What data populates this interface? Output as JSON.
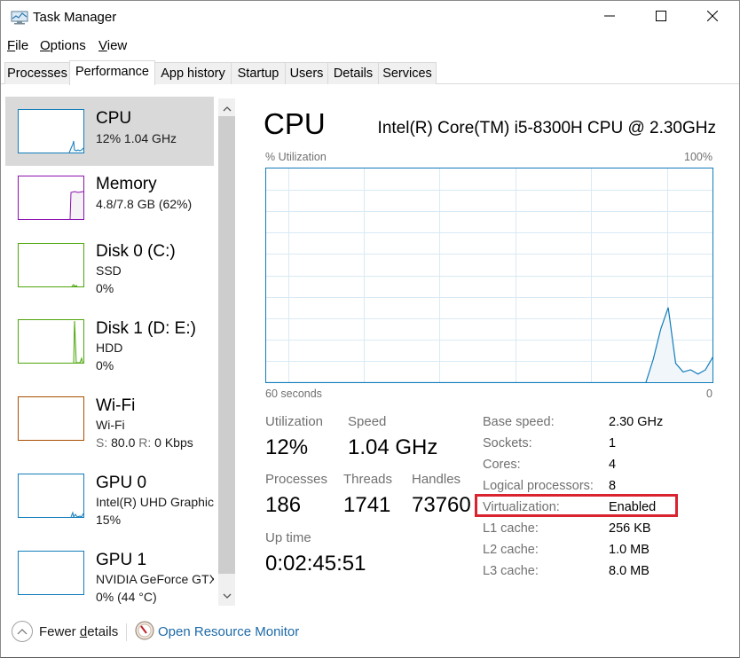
{
  "window": {
    "title": "Task Manager",
    "icon": "task-manager-icon",
    "controls": [
      "minimize-icon",
      "maximize-icon",
      "close-icon"
    ]
  },
  "menu": {
    "items": [
      {
        "label": "File",
        "accel": "F",
        "rest": "ile"
      },
      {
        "label": "Options",
        "accel": "O",
        "rest": "ptions"
      },
      {
        "label": "View",
        "accel": "V",
        "rest": "iew"
      }
    ]
  },
  "tabs": [
    {
      "label": "Processes",
      "active": false
    },
    {
      "label": "Performance",
      "active": true
    },
    {
      "label": "App history",
      "active": false
    },
    {
      "label": "Startup",
      "active": false
    },
    {
      "label": "Users",
      "active": false
    },
    {
      "label": "Details",
      "active": false
    },
    {
      "label": "Services",
      "active": false
    }
  ],
  "sidebar": {
    "items": [
      {
        "title": "CPU",
        "line1": "12%  1.04 GHz",
        "line2": "",
        "color": "#117dbb",
        "fill": "#f1f6fa",
        "selected": true
      },
      {
        "title": "Memory",
        "line1": "4.8/7.8 GB (62%)",
        "line2": "",
        "color": "#8b12ae",
        "fill": "#f4f2f4",
        "selected": false,
        "usage": 0.62
      },
      {
        "title": "Disk 0 (C:)",
        "line1": "SSD",
        "line2": "0%",
        "color": "#4da60c",
        "fill": "#eff7e9",
        "selected": false
      },
      {
        "title": "Disk 1 (D: E:)",
        "line1": "HDD",
        "line2": "0%",
        "color": "#4da60c",
        "fill": "#eff7e9",
        "selected": false
      },
      {
        "title": "Wi-Fi",
        "line1": "Wi-Fi",
        "line2_s_label": "S:",
        "line2_s_value": "80.0",
        "line2_r_label": "R:",
        "line2_r_value": "0 Kbps",
        "color": "#a74f01",
        "fill": "#fcf3eb",
        "selected": false
      },
      {
        "title": "GPU 0",
        "line1": "Intel(R) UHD Graphics",
        "line2": "15%",
        "color": "#117dbb",
        "fill": "#f1f6fa",
        "selected": false
      },
      {
        "title": "GPU 1",
        "line1": "NVIDIA GeForce GTX",
        "line2": "0%  (44 °C)",
        "color": "#117dbb",
        "fill": "#f1f6fa",
        "selected": false
      }
    ]
  },
  "main": {
    "title": "CPU",
    "cpu_name": "Intel(R) Core(TM) i5-8300H CPU @ 2.30GHz",
    "graph": {
      "y_label": "% Utilization",
      "y_max_label": "100%",
      "x_left_label": "60 seconds",
      "x_right_label": "0"
    },
    "stats": {
      "utilization_label": "Utilization",
      "utilization_value": "12%",
      "speed_label": "Speed",
      "speed_value": "1.04 GHz",
      "processes_label": "Processes",
      "processes_value": "186",
      "threads_label": "Threads",
      "threads_value": "1741",
      "handles_label": "Handles",
      "handles_value": "73760",
      "uptime_label": "Up time",
      "uptime_value": "0:02:45:51"
    },
    "specs": [
      {
        "label": "Base speed:",
        "value": "2.30 GHz"
      },
      {
        "label": "Sockets:",
        "value": "1"
      },
      {
        "label": "Cores:",
        "value": "4"
      },
      {
        "label": "Logical processors:",
        "value": "8"
      },
      {
        "label": "Virtualization:",
        "value": "Enabled",
        "highlighted": true
      },
      {
        "label": "L1 cache:",
        "value": "256 KB"
      },
      {
        "label": "L2 cache:",
        "value": "1.0 MB"
      },
      {
        "label": "L3 cache:",
        "value": "8.0 MB"
      }
    ],
    "highlight_color": "#d9232e"
  },
  "footer": {
    "fewer_details_prefix": "Fewer ",
    "fewer_details_accel": "d",
    "fewer_details_suffix": "etails",
    "resource_monitor_label": "Open Resource Monitor"
  },
  "chart_data": {
    "type": "area",
    "title": "% Utilization",
    "xlabel": "60 seconds",
    "ylabel": "% Utilization",
    "x_range": [
      60,
      0
    ],
    "ylim": [
      0,
      100
    ],
    "grid": true,
    "color": "#117dbb",
    "fill": "#f1f6fa",
    "x": [
      60,
      19,
      18,
      17,
      16,
      15,
      14,
      13,
      12,
      11,
      10,
      9,
      8,
      7,
      6,
      5,
      4,
      3,
      2,
      1,
      0
    ],
    "values": [
      0,
      0,
      0,
      0,
      0,
      0,
      0,
      0,
      0,
      0,
      0,
      0,
      11,
      25,
      35,
      9,
      5,
      6,
      4,
      6,
      12
    ]
  }
}
